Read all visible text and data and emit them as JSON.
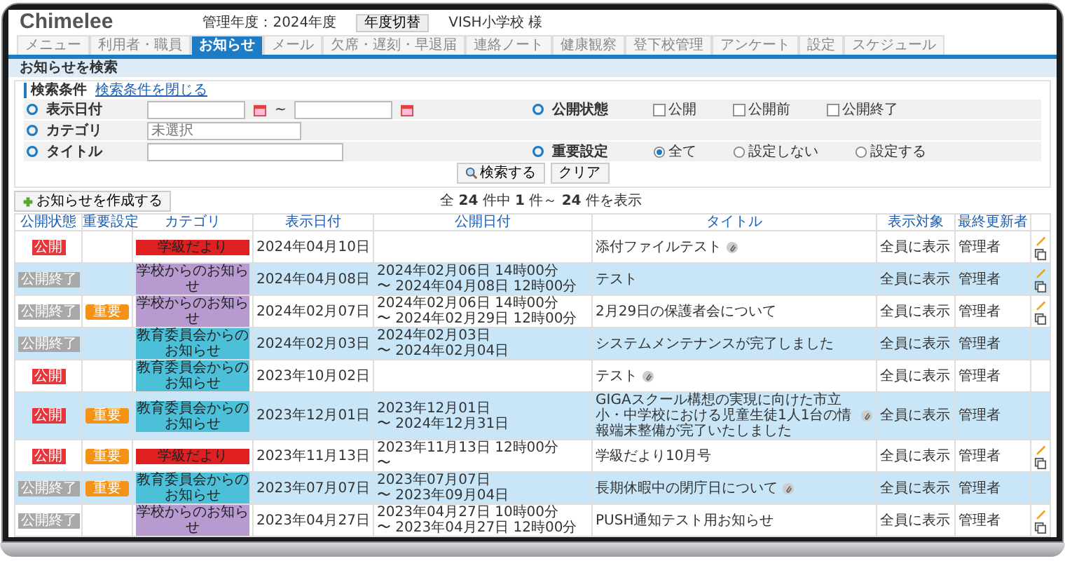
{
  "header": {
    "logo": "Chimelee",
    "fiscal_year": "管理年度：2024年度",
    "year_switch": "年度切替",
    "school": "VISH小学校 様"
  },
  "tabs": [
    {
      "label": "メニュー",
      "selected": false
    },
    {
      "label": "利用者・職員",
      "selected": false
    },
    {
      "label": "お知らせ",
      "selected": true
    },
    {
      "label": "メール",
      "selected": false
    },
    {
      "label": "欠席・遅刻・早退届",
      "selected": false
    },
    {
      "label": "連絡ノート",
      "selected": false
    },
    {
      "label": "健康観察",
      "selected": false
    },
    {
      "label": "登下校管理",
      "selected": false
    },
    {
      "label": "アンケート",
      "selected": false
    },
    {
      "label": "設定",
      "selected": false
    },
    {
      "label": "スケジュール",
      "selected": false
    }
  ],
  "page_title": "お知らせを検索",
  "search": {
    "heading": "検索条件",
    "toggle": "検索条件を閉じる",
    "date_label": "表示日付",
    "date_separator": "~",
    "status_label": "公開状態",
    "status_options": [
      {
        "label": "公開",
        "checked": false
      },
      {
        "label": "公開前",
        "checked": false
      },
      {
        "label": "公開終了",
        "checked": false
      }
    ],
    "category_label": "カテゴリ",
    "category_placeholder": "未選択",
    "title_label": "タイトル",
    "importance_label": "重要設定",
    "importance_options": [
      {
        "label": "全て",
        "selected": true
      },
      {
        "label": "設定しない",
        "selected": false
      },
      {
        "label": "設定する",
        "selected": false
      }
    ],
    "search_button": "検索する",
    "clear_button": "クリア"
  },
  "create_button": "お知らせを作成する",
  "result_count": "全 **24** 件中 **1** 件～ **24** 件を表示",
  "table": {
    "columns": [
      "公開状態",
      "重要設定",
      "カテゴリ",
      "表示日付",
      "公開日付",
      "タイトル",
      "表示対象",
      "最終更新者"
    ],
    "rows": [
      {
        "status": {
          "label": "公開",
          "kind": "public"
        },
        "category": {
          "label": "学級だより",
          "color": "#e02020"
        },
        "display_date": "2024年04月10日",
        "period": [],
        "title": "添付ファイルテスト",
        "attachment": true,
        "target": "全員に表示",
        "updater": "管理者",
        "actions": true
      },
      {
        "status": {
          "label": "公開終了",
          "kind": "ended"
        },
        "category": {
          "label": "学校からのお知らせ",
          "color": "#b79ad0"
        },
        "display_date": "2024年04月08日",
        "period": [
          "2024年02月06日 14時00分",
          "〜 2024年04月08日 12時00分"
        ],
        "title": "テスト",
        "attachment": false,
        "target": "全員に表示",
        "updater": "管理者",
        "actions": true
      },
      {
        "status": {
          "label": "公開終了",
          "kind": "ended"
        },
        "importance": "重要",
        "category": {
          "label": "学校からのお知らせ",
          "color": "#b79ad0"
        },
        "display_date": "2024年02月07日",
        "period": [
          "2024年02月06日 14時00分",
          "〜 2024年02月29日 12時00分"
        ],
        "title": "2月29日の保護者会について",
        "attachment": false,
        "target": "全員に表示",
        "updater": "管理者",
        "actions": true
      },
      {
        "status": {
          "label": "公開終了",
          "kind": "ended"
        },
        "category": {
          "label": "教育委員会からのお知らせ",
          "color": "#4cc0d8"
        },
        "display_date": "2024年02月03日",
        "period": [
          "2024年02月03日",
          "〜 2024年02月04日"
        ],
        "title": "システムメンテナンスが完了しました",
        "attachment": false,
        "target": "全員に表示",
        "updater": "管理者",
        "actions": false
      },
      {
        "status": {
          "label": "公開",
          "kind": "public"
        },
        "category": {
          "label": "教育委員会からのお知らせ",
          "color": "#4cc0d8"
        },
        "display_date": "2023年10月02日",
        "period": [],
        "title": "テスト",
        "attachment": true,
        "target": "全員に表示",
        "updater": "管理者",
        "actions": false
      },
      {
        "status": {
          "label": "公開",
          "kind": "public"
        },
        "importance": "重要",
        "category": {
          "label": "教育委員会からのお知らせ",
          "color": "#4cc0d8"
        },
        "display_date": "2023年12月01日",
        "period": [
          "2023年12月01日",
          "〜 2024年12月31日"
        ],
        "title": "GIGAスクール構想の実現に向けた市立小・中学校における児童生徒1人1台の情報端末整備が完了いたしました",
        "attachment": true,
        "target": "全員に表示",
        "updater": "管理者",
        "actions": false
      },
      {
        "status": {
          "label": "公開",
          "kind": "public"
        },
        "importance": "重要",
        "category": {
          "label": "学級だより",
          "color": "#e02020"
        },
        "display_date": "2023年11月13日",
        "period": [
          "2023年11月13日 12時00分",
          "〜"
        ],
        "title": "学級だより10月号",
        "attachment": false,
        "target": "全員に表示",
        "updater": "管理者",
        "actions": true
      },
      {
        "status": {
          "label": "公開終了",
          "kind": "ended"
        },
        "importance": "重要",
        "category": {
          "label": "教育委員会からのお知らせ",
          "color": "#4cc0d8"
        },
        "display_date": "2023年07月07日",
        "period": [
          "2023年07月07日",
          "〜 2023年09月04日"
        ],
        "title": "長期休暇中の閉庁日について",
        "attachment": true,
        "target": "全員に表示",
        "updater": "管理者",
        "actions": false
      },
      {
        "status": {
          "label": "公開終了",
          "kind": "ended"
        },
        "category": {
          "label": "学校からのお知らせ",
          "color": "#b79ad0"
        },
        "display_date": "2023年04月27日",
        "period": [
          "2023年04月27日 10時00分",
          "〜 2023年04月27日 12時00分"
        ],
        "title": "PUSH通知テスト用お知らせ",
        "attachment": false,
        "target": "全員に表示",
        "updater": "管理者",
        "actions": true
      }
    ]
  }
}
